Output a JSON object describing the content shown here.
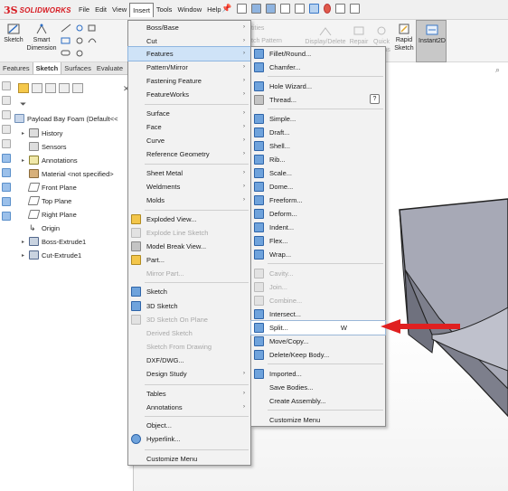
{
  "app": {
    "logo_prefix": "3S",
    "logo_text": "SOLIDWORKS",
    "brand_color": "#d71920"
  },
  "menubar": {
    "items": [
      "File",
      "Edit",
      "View",
      "Insert",
      "Tools",
      "Window",
      "Help"
    ],
    "active": "Insert"
  },
  "command_manager": {
    "sketch": "Sketch",
    "smart_dimension_line1": "Smart",
    "smart_dimension_line2": "Dimension",
    "ghost_1": "tities",
    "ghost_2": "tch Pattern",
    "display_delete": "Display/Delete",
    "repair": "Repair",
    "quick": "Quick",
    "quick_snaps": "Snaps",
    "rapid": "Rapid",
    "rapid_sketch": "Sketch",
    "instant2d": "Instant2D"
  },
  "feature_manager": {
    "tabs": [
      "Features",
      "Sketch",
      "Surfaces",
      "Evaluate"
    ],
    "active_tab": "Sketch",
    "tree": [
      {
        "label": "Payload Bay Foam  (Default<<",
        "icon": "part",
        "indent": 0,
        "arrow": ""
      },
      {
        "label": "History",
        "icon": "hist",
        "indent": 1,
        "arrow": "▸"
      },
      {
        "label": "Sensors",
        "icon": "sens",
        "indent": 1,
        "arrow": ""
      },
      {
        "label": "Annotations",
        "icon": "ann",
        "indent": 1,
        "arrow": "▸"
      },
      {
        "label": "Material <not specified>",
        "icon": "mat",
        "indent": 1,
        "arrow": ""
      },
      {
        "label": "Front Plane",
        "icon": "plane",
        "indent": 1,
        "arrow": ""
      },
      {
        "label": "Top Plane",
        "icon": "plane",
        "indent": 1,
        "arrow": ""
      },
      {
        "label": "Right Plane",
        "icon": "plane",
        "indent": 1,
        "arrow": ""
      },
      {
        "label": "Origin",
        "icon": "origin",
        "indent": 1,
        "arrow": ""
      },
      {
        "label": "Boss-Extrude1",
        "icon": "feat",
        "indent": 1,
        "arrow": "▸"
      },
      {
        "label": "Cut-Extrude1",
        "icon": "feat",
        "indent": 1,
        "arrow": "▸"
      }
    ]
  },
  "insert_menu": {
    "items": [
      {
        "label": "Boss/Base",
        "sub": true,
        "icon": "",
        "disabled": false
      },
      {
        "label": "Cut",
        "sub": true,
        "icon": "",
        "disabled": false
      },
      {
        "label": "Features",
        "sub": true,
        "icon": "",
        "disabled": false,
        "highlighted": true
      },
      {
        "label": "Pattern/Mirror",
        "sub": true,
        "icon": "",
        "disabled": false
      },
      {
        "label": "Fastening Feature",
        "sub": true,
        "icon": "",
        "disabled": false
      },
      {
        "label": "FeatureWorks",
        "sub": true,
        "icon": "",
        "disabled": false
      },
      {
        "separator": true
      },
      {
        "label": "Surface",
        "sub": true,
        "icon": "",
        "disabled": false
      },
      {
        "label": "Face",
        "sub": true,
        "icon": "",
        "disabled": false
      },
      {
        "label": "Curve",
        "sub": true,
        "icon": "",
        "disabled": false
      },
      {
        "label": "Reference Geometry",
        "sub": true,
        "icon": "",
        "disabled": false
      },
      {
        "separator": true
      },
      {
        "label": "Sheet Metal",
        "sub": true,
        "icon": "",
        "disabled": false
      },
      {
        "label": "Weldments",
        "sub": true,
        "icon": "",
        "disabled": false
      },
      {
        "label": "Molds",
        "sub": true,
        "icon": "",
        "disabled": false
      },
      {
        "separator": true
      },
      {
        "label": "Exploded View...",
        "sub": false,
        "icon": "yellow",
        "disabled": false
      },
      {
        "label": "Explode Line Sketch",
        "sub": false,
        "icon": "light",
        "disabled": true
      },
      {
        "label": "Model Break View...",
        "sub": false,
        "icon": "gray",
        "disabled": false
      },
      {
        "label": "Part...",
        "sub": false,
        "icon": "yellow",
        "disabled": false
      },
      {
        "label": "Mirror Part...",
        "sub": false,
        "icon": "",
        "disabled": true
      },
      {
        "separator": true
      },
      {
        "label": "Sketch",
        "sub": false,
        "icon": "blue",
        "disabled": false
      },
      {
        "label": "3D Sketch",
        "sub": false,
        "icon": "blue",
        "disabled": false
      },
      {
        "label": "3D Sketch On Plane",
        "sub": false,
        "icon": "light",
        "disabled": true
      },
      {
        "label": "Derived Sketch",
        "sub": false,
        "icon": "",
        "disabled": true
      },
      {
        "label": "Sketch From Drawing",
        "sub": false,
        "icon": "",
        "disabled": true
      },
      {
        "label": "DXF/DWG...",
        "sub": false,
        "icon": "",
        "disabled": false
      },
      {
        "label": "Design Study",
        "sub": true,
        "icon": "",
        "disabled": false
      },
      {
        "separator": true
      },
      {
        "label": "Tables",
        "sub": true,
        "icon": "",
        "disabled": false
      },
      {
        "label": "Annotations",
        "sub": true,
        "icon": "",
        "disabled": false
      },
      {
        "separator": true
      },
      {
        "label": "Object...",
        "sub": false,
        "icon": "",
        "disabled": false
      },
      {
        "label": "Hyperlink...",
        "sub": false,
        "icon": "blue-round",
        "disabled": false
      },
      {
        "separator": true
      },
      {
        "label": "Customize Menu",
        "sub": false,
        "icon": "",
        "disabled": false
      }
    ]
  },
  "features_submenu": {
    "items": [
      {
        "label": "Fillet/Round...",
        "icon": "blue",
        "disabled": false
      },
      {
        "label": "Chamfer...",
        "icon": "blue",
        "disabled": false
      },
      {
        "separator": true
      },
      {
        "label": "Hole Wizard...",
        "icon": "blue",
        "disabled": false
      },
      {
        "label": "Thread...",
        "icon": "gray",
        "disabled": false,
        "help": "?"
      },
      {
        "separator": true
      },
      {
        "label": "Simple...",
        "icon": "blue",
        "disabled": false
      },
      {
        "label": "Draft...",
        "icon": "blue",
        "disabled": false
      },
      {
        "label": "Shell...",
        "icon": "blue",
        "disabled": false
      },
      {
        "label": "Rib...",
        "icon": "blue",
        "disabled": false
      },
      {
        "label": "Scale...",
        "icon": "blue",
        "disabled": false
      },
      {
        "label": "Dome...",
        "icon": "blue",
        "disabled": false
      },
      {
        "label": "Freeform...",
        "icon": "blue",
        "disabled": false
      },
      {
        "label": "Deform...",
        "icon": "blue",
        "disabled": false
      },
      {
        "label": "Indent...",
        "icon": "blue",
        "disabled": false
      },
      {
        "label": "Flex...",
        "icon": "blue",
        "disabled": false
      },
      {
        "label": "Wrap...",
        "icon": "blue",
        "disabled": false
      },
      {
        "separator": true
      },
      {
        "label": "Cavity...",
        "icon": "light",
        "disabled": true
      },
      {
        "label": "Join...",
        "icon": "light",
        "disabled": true
      },
      {
        "label": "Combine...",
        "icon": "light",
        "disabled": true
      },
      {
        "label": "Intersect...",
        "icon": "blue",
        "disabled": false
      },
      {
        "label": "Split...",
        "icon": "blue",
        "disabled": false,
        "shortcut": "W",
        "selected": true
      },
      {
        "label": "Move/Copy...",
        "icon": "blue",
        "disabled": false
      },
      {
        "label": "Delete/Keep Body...",
        "icon": "blue",
        "disabled": false
      },
      {
        "separator": true
      },
      {
        "label": "Imported...",
        "icon": "blue",
        "disabled": false
      },
      {
        "label": "Save Bodies...",
        "icon": "",
        "disabled": false
      },
      {
        "label": "Create Assembly...",
        "icon": "",
        "disabled": false
      },
      {
        "separator": true
      },
      {
        "label": "Customize Menu",
        "icon": "",
        "disabled": false
      }
    ]
  },
  "annotation": {
    "arrow_color": "#e02020"
  }
}
